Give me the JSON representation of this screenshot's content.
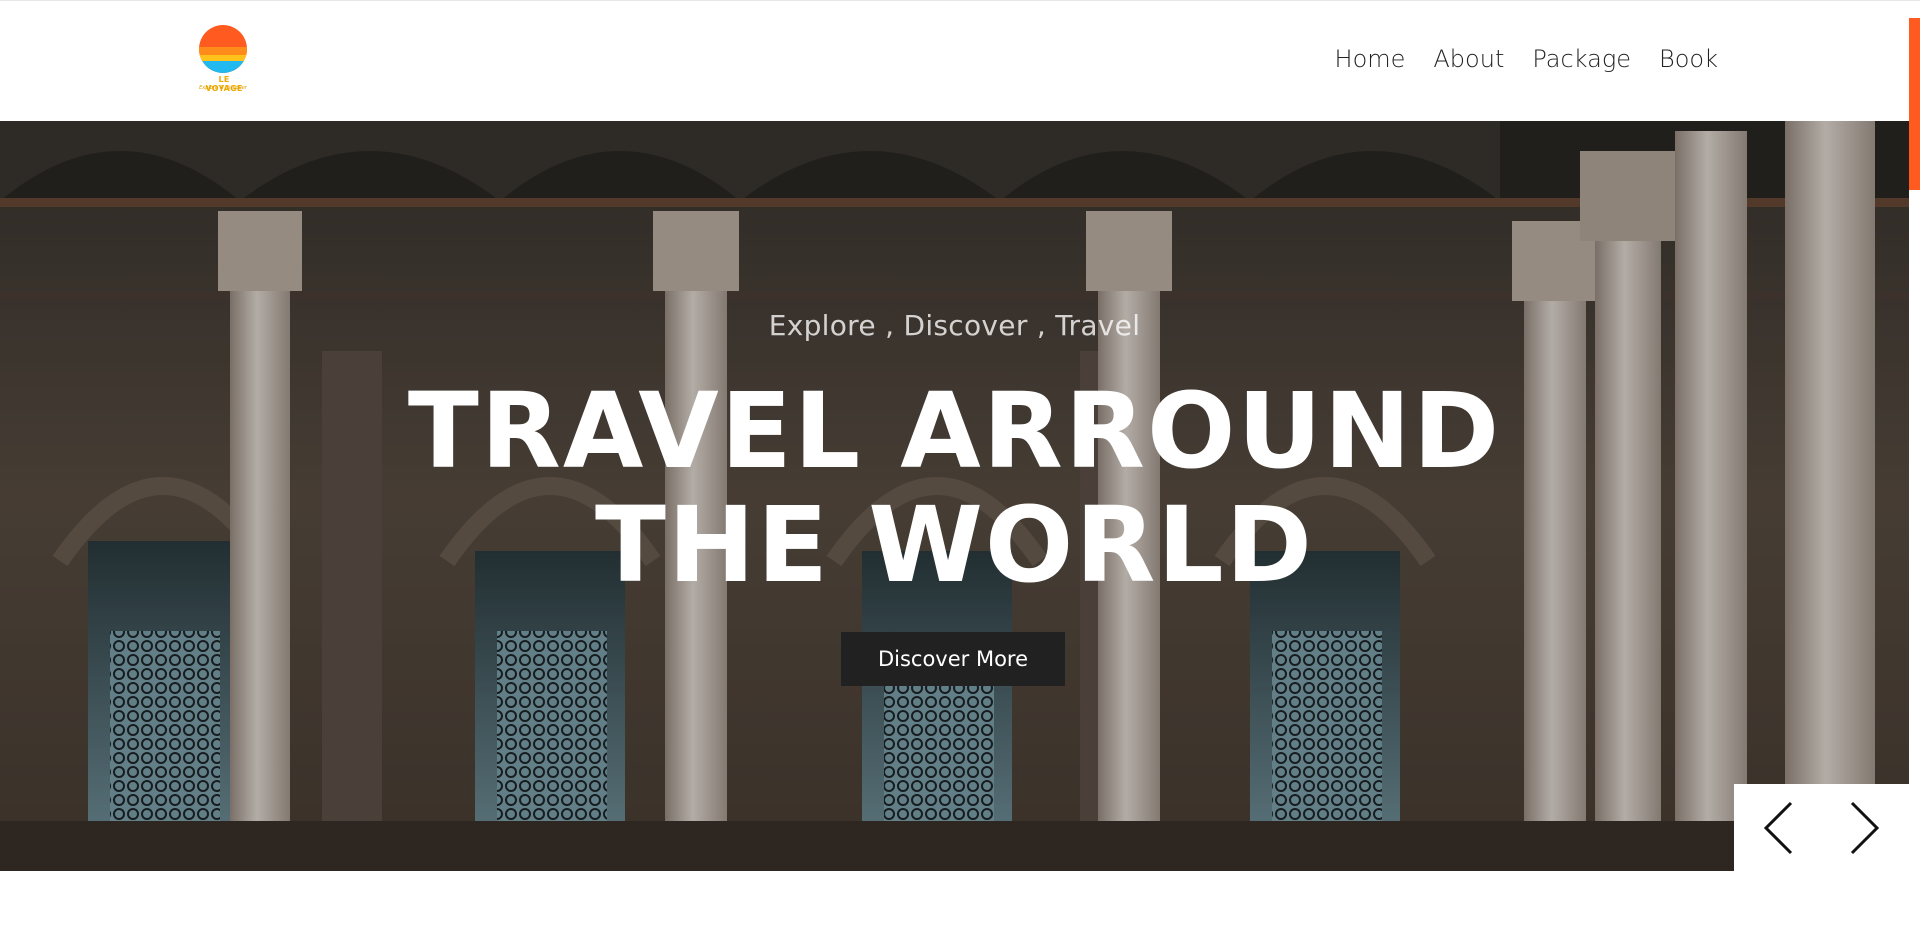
{
  "brand": {
    "name": "LE VOYAGE",
    "tagline": "Explore & Discover",
    "colors": {
      "sun": "#ff6b1a",
      "sea": "#22b8f0",
      "accent": "#ff5a1f"
    }
  },
  "nav": {
    "items": [
      {
        "label": "Home"
      },
      {
        "label": "About"
      },
      {
        "label": "Package"
      },
      {
        "label": "Book"
      }
    ]
  },
  "hero": {
    "subtitle": "Explore , Discover , Travel",
    "title_line1": "TRAVEL ARROUND",
    "title_line2": "THE WORLD",
    "cta_label": "Discover More",
    "background": "mosque arcade with stone columns and ornate iron windows"
  },
  "slider": {
    "prev_icon": "chevron-left-icon",
    "next_icon": "chevron-right-icon"
  }
}
